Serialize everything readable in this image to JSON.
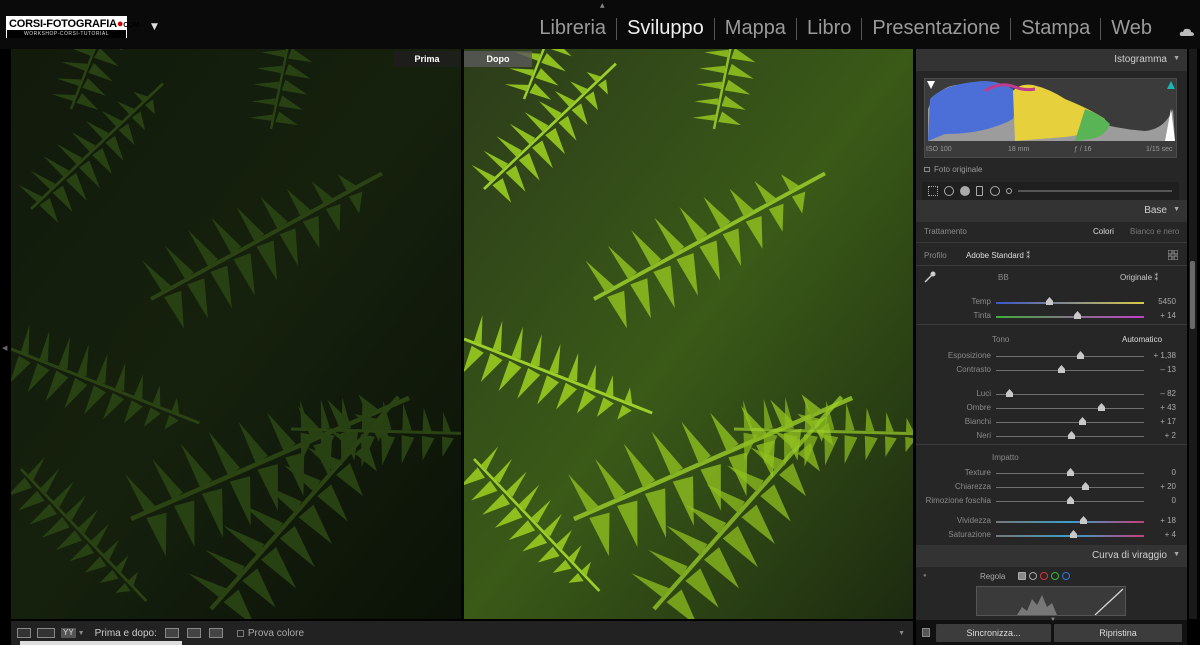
{
  "logo": {
    "main": "CORSI-FOTOGRAFIA",
    "dot": "●",
    "tld": "COM",
    "sub": "WORKSHOP-CORSI-TUTORIAL"
  },
  "modules": [
    "Libreria",
    "Sviluppo",
    "Mappa",
    "Libro",
    "Presentazione",
    "Stampa",
    "Web"
  ],
  "active_module": "Sviluppo",
  "viewer": {
    "before_label": "Prima",
    "after_label": "Dopo"
  },
  "toolbar": {
    "yy_label": "YY",
    "before_after_label": "Prima e dopo:",
    "proof_label": "Prova colore"
  },
  "histogram": {
    "title": "Istogramma",
    "iso": "ISO 100",
    "focal": "18 mm",
    "aperture": "ƒ / 16",
    "shutter": "1/15 sec",
    "original_photo": "Foto originale"
  },
  "base": {
    "title": "Base",
    "treatment_label": "Trattamento",
    "treatment_color": "Colori",
    "treatment_bw": "Bianco e nero",
    "profile_label": "Profilo",
    "profile_value": "Adobe Standard",
    "profile_caret": "⁑",
    "wb_label": "BB",
    "wb_value": "Originale",
    "wb_caret": "⁑",
    "tone_label": "Tono",
    "auto_label": "Automatico",
    "presence_label": "Impatto",
    "sliders": [
      {
        "label": "Temp",
        "value": "5450",
        "pos": 0.36
      },
      {
        "label": "Tinta",
        "value": "+ 14",
        "pos": 0.55
      },
      {
        "label": "Esposizione",
        "value": "+ 1,38",
        "pos": 0.57
      },
      {
        "label": "Contrasto",
        "value": "– 13",
        "pos": 0.44
      },
      {
        "label": "Luci",
        "value": "– 82",
        "pos": 0.09
      },
      {
        "label": "Ombre",
        "value": "+ 43",
        "pos": 0.71
      },
      {
        "label": "Bianchi",
        "value": "+ 17",
        "pos": 0.58
      },
      {
        "label": "Neri",
        "value": "+ 2",
        "pos": 0.51
      },
      {
        "label": "Texture",
        "value": "0",
        "pos": 0.5
      },
      {
        "label": "Chiarezza",
        "value": "+ 20",
        "pos": 0.6
      },
      {
        "label": "Rimozione foschia",
        "value": "0",
        "pos": 0.5
      },
      {
        "label": "Vividezza",
        "value": "+ 18",
        "pos": 0.59
      },
      {
        "label": "Saturazione",
        "value": "+ 4",
        "pos": 0.52
      }
    ]
  },
  "tone_curve": {
    "title": "Curva di viraggio",
    "adjust_label": "Regola"
  },
  "footer": {
    "sync": "Sincronizza...",
    "reset": "Ripristina"
  },
  "colors": {
    "accent_green": "#8fbf1f",
    "panel_bg": "#262626"
  }
}
